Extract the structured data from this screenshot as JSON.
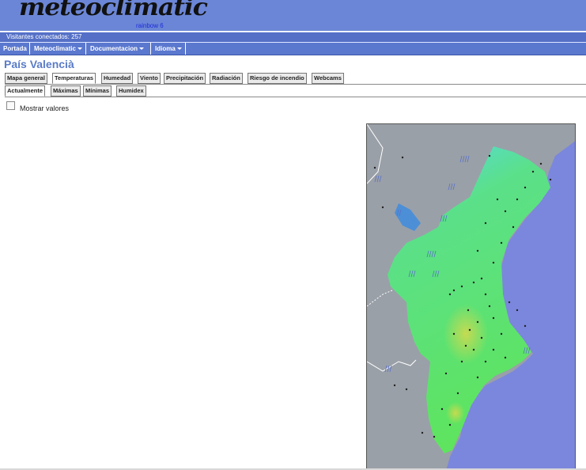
{
  "header": {
    "logo": "meteoclimatic",
    "version": "rainbow 6"
  },
  "visitors": {
    "text": "Visitantes conectados: 257"
  },
  "nav": {
    "items": [
      {
        "label": "Portada",
        "dropdown": false
      },
      {
        "label": "Meteoclimatic",
        "dropdown": true
      },
      {
        "label": "Documentacion",
        "dropdown": true
      },
      {
        "label": "Idioma",
        "dropdown": true
      }
    ]
  },
  "page": {
    "title": "País Valencià"
  },
  "tabs": {
    "main": [
      "Mapa general",
      "Temperaturas",
      "Humedad",
      "Viento",
      "Precipitación",
      "Radiación",
      "Riesgo de incendio",
      "Webcams"
    ],
    "main_active": "Temperaturas",
    "sub": [
      "Actualmente",
      "Máximas",
      "Mínimas",
      "Humidex"
    ],
    "sub_active": "Actualmente"
  },
  "options": {
    "show_values_label": "Mostrar valores",
    "show_values_checked": false
  },
  "colors": {
    "header_bg": "#6b86d6",
    "title": "#5a7cc8",
    "sea": "#7b87dc",
    "land": "#9aa0a8",
    "region_warm": "#5ee26a",
    "region_cool": "#55d9f0"
  }
}
